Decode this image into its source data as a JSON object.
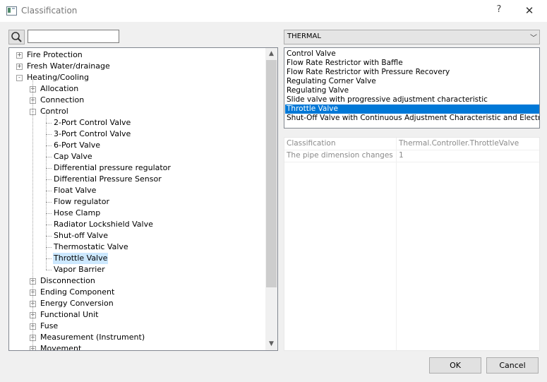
{
  "window": {
    "title": "Classification",
    "help": "?",
    "close": "✕"
  },
  "search": {
    "value": "",
    "placeholder": ""
  },
  "tree": [
    {
      "label": "Fire Protection",
      "level": 0,
      "expander": "+"
    },
    {
      "label": "Fresh Water/drainage",
      "level": 0,
      "expander": "+"
    },
    {
      "label": "Heating/Cooling",
      "level": 0,
      "expander": "-"
    },
    {
      "label": "Allocation",
      "level": 1,
      "expander": "+"
    },
    {
      "label": "Connection",
      "level": 1,
      "expander": "+"
    },
    {
      "label": "Control",
      "level": 1,
      "expander": "-"
    },
    {
      "label": "2-Port Control Valve",
      "level": 2,
      "expander": ""
    },
    {
      "label": "3-Port Control Valve",
      "level": 2,
      "expander": ""
    },
    {
      "label": "6-Port Valve",
      "level": 2,
      "expander": ""
    },
    {
      "label": "Cap Valve",
      "level": 2,
      "expander": ""
    },
    {
      "label": "Differential pressure regulator",
      "level": 2,
      "expander": ""
    },
    {
      "label": "Differential Pressure Sensor",
      "level": 2,
      "expander": ""
    },
    {
      "label": "Float Valve",
      "level": 2,
      "expander": ""
    },
    {
      "label": "Flow regulator",
      "level": 2,
      "expander": ""
    },
    {
      "label": "Hose Clamp",
      "level": 2,
      "expander": ""
    },
    {
      "label": "Radiator Lockshield Valve",
      "level": 2,
      "expander": ""
    },
    {
      "label": "Shut-off Valve",
      "level": 2,
      "expander": ""
    },
    {
      "label": "Thermostatic Valve",
      "level": 2,
      "expander": ""
    },
    {
      "label": "Throttle Valve",
      "level": 2,
      "expander": "",
      "selected": true
    },
    {
      "label": "Vapor Barrier",
      "level": 2,
      "expander": ""
    },
    {
      "label": "Disconnection",
      "level": 1,
      "expander": "+"
    },
    {
      "label": "Ending Component",
      "level": 1,
      "expander": "+"
    },
    {
      "label": "Energy Conversion",
      "level": 1,
      "expander": "+"
    },
    {
      "label": "Functional Unit",
      "level": 1,
      "expander": "+"
    },
    {
      "label": "Fuse",
      "level": 1,
      "expander": "+"
    },
    {
      "label": "Measurement (Instrument)",
      "level": 1,
      "expander": "+"
    },
    {
      "label": "Movement",
      "level": 1,
      "expander": "+"
    }
  ],
  "combo": {
    "value": "THERMAL"
  },
  "list": [
    {
      "label": "Control Valve"
    },
    {
      "label": "Flow Rate Restrictor with Baffle"
    },
    {
      "label": "Flow Rate Restrictor with Pressure Recovery"
    },
    {
      "label": "Regulating Corner Valve"
    },
    {
      "label": "Regulating Valve"
    },
    {
      "label": "Slide valve with progressive adjustment characteristic"
    },
    {
      "label": "Throttle Valve",
      "selected": true
    },
    {
      "label": "Shut-Off Valve with Continuous Adjustment Characteristic and Electric Mot"
    }
  ],
  "properties": [
    {
      "name": "Classification",
      "value": "Thermal.Controller.ThrottleValve"
    },
    {
      "name": "The pipe dimension changes ...",
      "value": "1"
    }
  ],
  "buttons": {
    "ok": "OK",
    "cancel": "Cancel"
  },
  "colors": {
    "selection": "#0078d7",
    "tree_selection": "#cce8ff"
  }
}
